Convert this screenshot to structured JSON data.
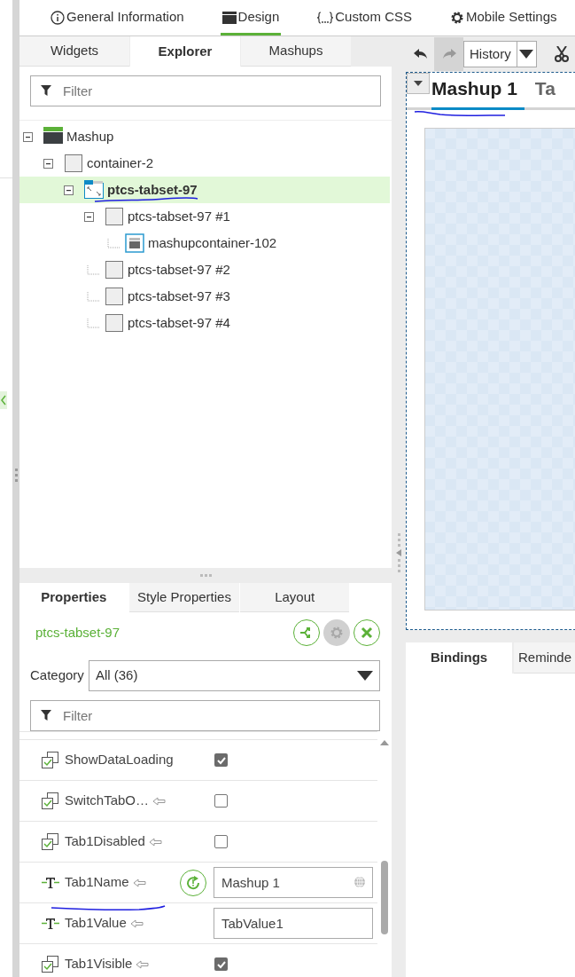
{
  "top_tabs": [
    {
      "label": "General Information",
      "selected": false
    },
    {
      "label": "Design",
      "selected": true
    },
    {
      "label": "Custom CSS",
      "selected": false
    },
    {
      "label": "Mobile Settings",
      "selected": false
    }
  ],
  "explorer": {
    "tabs": [
      {
        "label": "Widgets",
        "selected": false
      },
      {
        "label": "Explorer",
        "selected": true
      },
      {
        "label": "Mashups",
        "selected": false
      }
    ],
    "filter": {
      "placeholder": "Filter"
    },
    "tree": [
      {
        "label": "Mashup",
        "kind": "mashup",
        "selected": false,
        "expanded": true,
        "children": [
          {
            "label": "container-2",
            "kind": "container",
            "selected": false,
            "expanded": true,
            "children": [
              {
                "label": "ptcs-tabset-97",
                "kind": "tabset",
                "selected": true,
                "expanded": true,
                "children": [
                  {
                    "label": "ptcs-tabset-97 #1",
                    "kind": "tab",
                    "selected": false,
                    "expanded": true,
                    "children": [
                      {
                        "label": "mashupcontainer-102",
                        "kind": "mashupcontainer",
                        "selected": false
                      }
                    ]
                  },
                  {
                    "label": "ptcs-tabset-97 #2",
                    "kind": "tab",
                    "selected": false
                  },
                  {
                    "label": "ptcs-tabset-97 #3",
                    "kind": "tab",
                    "selected": false
                  },
                  {
                    "label": "ptcs-tabset-97 #4",
                    "kind": "tab",
                    "selected": false
                  }
                ]
              }
            ]
          }
        ]
      }
    ]
  },
  "properties": {
    "tabs": [
      {
        "label": "Properties",
        "selected": true
      },
      {
        "label": "Style Properties",
        "selected": false
      },
      {
        "label": "Layout",
        "selected": false
      }
    ],
    "widget_name": "ptcs-tabset-97",
    "category": {
      "label": "Category",
      "value": "All (36)"
    },
    "filter": {
      "placeholder": "Filter"
    },
    "rows": [
      {
        "kind": "boolean",
        "name": "ShowDataLoading",
        "bindable": false,
        "checked": true
      },
      {
        "kind": "boolean",
        "name": "SwitchTabO…",
        "bindable": true,
        "checked": false
      },
      {
        "kind": "boolean",
        "name": "Tab1Disabled",
        "bindable": true,
        "checked": false
      },
      {
        "kind": "string",
        "name": "Tab1Name",
        "bindable": true,
        "value": "Mashup 1",
        "modified": true,
        "localizable": true
      },
      {
        "kind": "string",
        "name": "Tab1Value",
        "bindable": true,
        "value": "TabValue1",
        "modified": false,
        "localizable": false
      },
      {
        "kind": "boolean",
        "name": "Tab1Visible",
        "bindable": true,
        "checked": true
      }
    ]
  },
  "designer": {
    "history": "History",
    "undo_disabled": false,
    "redo_disabled": true,
    "canvas_tabs": [
      {
        "label": "Mashup 1",
        "selected": true
      },
      {
        "label": "Ta",
        "selected": false
      }
    ]
  },
  "bottom_tabs": [
    {
      "label": "Bindings",
      "selected": true
    },
    {
      "label": "Reminde",
      "selected": false
    }
  ]
}
